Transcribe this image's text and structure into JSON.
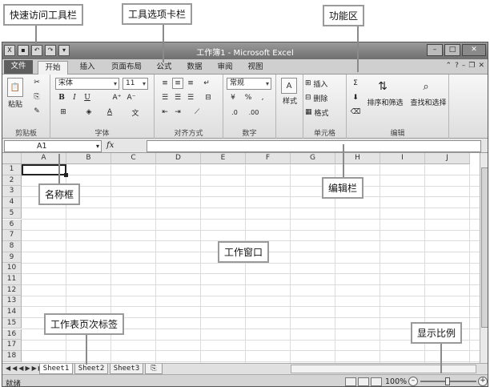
{
  "annotations": {
    "quick_access_toolbar": "快速访问工具栏",
    "tab_bar": "工具选项卡栏",
    "ribbon": "功能区",
    "name_box": "名称框",
    "formula_bar": "编辑栏",
    "work_window": "工作窗口",
    "sheet_tabs": "工作表页次标签",
    "zoom": "显示比例"
  },
  "window": {
    "title": "工作簿1 - Microsoft Excel"
  },
  "tabs": {
    "file": "文件",
    "items": [
      "开始",
      "插入",
      "页面布局",
      "公式",
      "数据",
      "审阅",
      "视图"
    ]
  },
  "ribbon": {
    "clipboard": {
      "label": "剪贴板",
      "paste": "粘贴"
    },
    "font": {
      "label": "字体",
      "font_name": "宋体",
      "font_size": "11"
    },
    "alignment": {
      "label": "对齐方式"
    },
    "number": {
      "label": "数字",
      "format": "常规"
    },
    "styles": {
      "label": "样式",
      "button": "样式"
    },
    "cells": {
      "label": "单元格",
      "insert": "插入",
      "delete": "删除",
      "format": "格式"
    },
    "editing": {
      "label": "编辑",
      "sort_filter": "排序和筛选",
      "find_select": "查找和选择"
    }
  },
  "formula_bar": {
    "name_box_value": "A1",
    "fx": "fx",
    "value": ""
  },
  "grid": {
    "columns": [
      "A",
      "B",
      "C",
      "D",
      "E",
      "F",
      "G",
      "H",
      "I",
      "J"
    ],
    "rows": [
      "1",
      "2",
      "3",
      "4",
      "5",
      "6",
      "7",
      "8",
      "9",
      "10",
      "11",
      "12",
      "13",
      "14",
      "15",
      "16",
      "17",
      "18"
    ]
  },
  "sheets": [
    "Sheet1",
    "Sheet2",
    "Sheet3"
  ],
  "status": {
    "ready": "就绪",
    "zoom": "100%"
  }
}
